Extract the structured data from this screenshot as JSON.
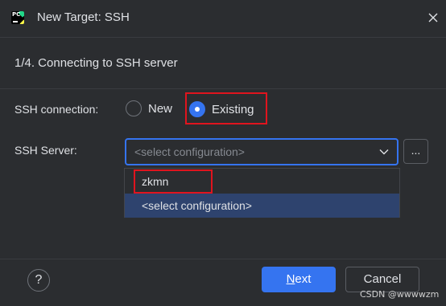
{
  "window": {
    "title": "New Target: SSH",
    "app_icon": "pycharm-icon",
    "close_icon": "close-icon"
  },
  "step": {
    "label": "1/4. Connecting to SSH server"
  },
  "connection": {
    "label": "SSH connection:",
    "options": [
      {
        "label": "New",
        "selected": false
      },
      {
        "label": "Existing",
        "selected": true
      }
    ]
  },
  "server": {
    "label": "SSH Server:",
    "value": "<select configuration>",
    "browse_label": "...",
    "dropdown_items": [
      {
        "label": "zkmn",
        "highlighted": false
      },
      {
        "label": "<select configuration>",
        "highlighted": true
      }
    ]
  },
  "footer": {
    "help_label": "?",
    "next_mnemonic": "N",
    "next_rest": "ext",
    "cancel_label": "Cancel"
  },
  "watermark": "CSDN @wwwwzm",
  "colors": {
    "accent": "#3574f0",
    "background": "#2b2d30",
    "selection": "#2e436e",
    "annotation_red": "#e0141e"
  }
}
